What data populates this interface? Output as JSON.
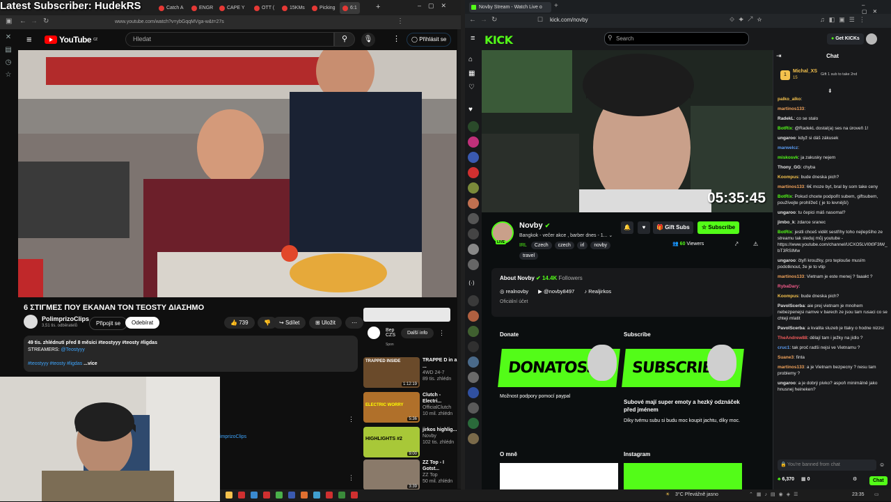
{
  "overlay": {
    "subscriber_text": "Latest Subscriber: HudekRS"
  },
  "left_browser": {
    "tabs": [
      "Catch A",
      "ENGR",
      "CAPE Y",
      "OTT (",
      "15KMs",
      "Picking",
      "6:1"
    ],
    "url": "www.youtube.com/watch?v=ybGqqMVga-w&t=27s",
    "youtube": {
      "logo": "YouTube",
      "region": "CZ",
      "search_placeholder": "Hledat",
      "signin": "Přihlásit se",
      "video_title": "6 ΣΤΙΓΜΕΣ ΠΟΥ ΕΚΑΝΑΝ ΤΟΝ ΤΕΟSTY ΔΙΑΣΗΜΟ",
      "channel_name": "PolimprizoClips",
      "channel_subs": "3,51 tis. odběratelů",
      "join_label": "Připojit se",
      "subscribe_label": "Odebírat",
      "likes": "739",
      "share_label": "Sdílet",
      "save_label": "Uložit",
      "desc_line1": "49 tis. zhlédnutí  před 8 měsíci  #teostyyy #teosty #ligdas",
      "desc_line2_prefix": "STREAMERS: ",
      "desc_line2_link": "@Teostyyy",
      "desc_line3": "#teostyyy #teosty #ligdas",
      "desc_more": "...více",
      "ad_title": "Bep CZS",
      "ad_sponsor": "Spon",
      "ad_button": "Další info",
      "comment_link": "imprizoClips",
      "recs": [
        {
          "title": "TRAPPE D in a ...",
          "channel": "4WD 24-7",
          "meta": "89 tis. zhlédn",
          "duration": "1:12:19",
          "thumb_text": "TRAPPED INSIDE",
          "color": "#6a4a2a"
        },
        {
          "title": "Clutch - Electri...",
          "channel": "OfficialClutch",
          "meta": "10 mil. zhlédn",
          "duration": "5:36",
          "thumb_text": "ELECTRIC WORRY",
          "color": "#b0702a"
        },
        {
          "title": "jirkos highlig...",
          "channel": "Novby",
          "meta": "102 tis. zhlédn",
          "duration": "9:00",
          "thumb_text": "HIGHLIGHTS #2",
          "color": "#a8c838"
        },
        {
          "title": "ZZ Top - I Gotst...",
          "channel": "ZZ Top",
          "meta": "50 mil. zhlédn",
          "duration": "3:39",
          "thumb_text": "",
          "color": "#8a7a6a"
        }
      ]
    }
  },
  "right_browser": {
    "tab_title": "Novby Stream - Watch Live o",
    "url": "kick.com/novby",
    "kick": {
      "logo": "KICK",
      "search_placeholder": "Search",
      "get_kicks": "Get KICKs",
      "timer": "05:35:45",
      "streamer_name": "Novby",
      "live_badge": "LIVE",
      "stream_title": "Bangkok - večer akce , barber dnes - 1...",
      "category": "IRL",
      "tags": [
        "Czech",
        "czech",
        "irl",
        "novby",
        "travel"
      ],
      "gift_subs": "Gift Subs",
      "subscribe": "Subscribe",
      "viewers": "60",
      "viewers_label": "Viewers",
      "about_title": "About Novby",
      "followers": "14.4K",
      "followers_label": "Followers",
      "socials": [
        "realnovby",
        "@novby8497",
        "Realjirkos"
      ],
      "official_account": "Oficiální účet",
      "panels": {
        "donate_title": "Donate",
        "donate_banner": "DONATOSS",
        "donate_text": "Možnost podpory pomocí paypal",
        "subscribe_title": "Subscribe",
        "subscribe_banner": "SUBSCRIBE",
        "subscribe_text1": "Subové mají super emoty a hezký odznáček před jménem",
        "subscribe_text2": "Díky tvému subu si budu moc koupit jachtu, díky moc.",
        "omne_title": "O mně",
        "instagram_title": "Instagram"
      }
    },
    "chat": {
      "title": "Chat",
      "pinned_user": "Michal_XS",
      "pinned_count": "15",
      "pinned_text": "Gift 1 sub to take 2nd",
      "messages": [
        {
          "user": "palko_alko",
          "color": "#f5c24d",
          "text": ""
        },
        {
          "user": "martinos133",
          "color": "#f2a35b",
          "text": ""
        },
        {
          "user": "RadekL",
          "color": "#e7e7e7",
          "text": "co se stalo"
        },
        {
          "user": "BotRix",
          "color": "#53fc18",
          "text": "@RadekL dostal(a) ses na úroveň 1!"
        },
        {
          "user": "ungaroo",
          "color": "#e7e7e7",
          "text": "když si dáš zákusek"
        },
        {
          "user": "marwelcz",
          "color": "#5b9cf2",
          "text": ""
        },
        {
          "user": "miskosvk",
          "color": "#53fc18",
          "text": "ja zakusky nejem"
        },
        {
          "user": "Thony_GG",
          "color": "#e7e7e7",
          "text": "chyba"
        },
        {
          "user": "Koompus",
          "color": "#f5c24d",
          "text": "bude dneska pich?"
        },
        {
          "user": "martinos133",
          "color": "#f2a35b",
          "text": "6€ moze byt, bral by som take ceny"
        },
        {
          "user": "BotRix",
          "color": "#53fc18",
          "text": "Pokud chcete podpořit subem, giftsubem, používejte prohlížeč ( je to levnější)"
        },
        {
          "user": "ungaroo",
          "color": "#e7e7e7",
          "text": "tu čepici máš nasomal?"
        },
        {
          "user": "jimbo_k",
          "color": "#e7e7e7",
          "text": "zdarce sranec"
        },
        {
          "user": "BotRix",
          "color": "#53fc18",
          "text": "jestli chceš vidět sestříhy toho nejlepšího ze streamu tak sleduj můj youtube - https://www.youtube.com/channel/UCXO5LVl0t0F3lW_bT3RSIMw"
        },
        {
          "user": "ungaroo",
          "color": "#e7e7e7",
          "text": "čtyři kroužky, pro teplouše musím podotknout, že je to vtip"
        },
        {
          "user": "martinos133",
          "color": "#f2a35b",
          "text": "Vietnam je este menej ? faaakt ?"
        },
        {
          "user": "RybaDary",
          "color": "#f25b8a",
          "text": ""
        },
        {
          "user": "Koompus",
          "color": "#f5c24d",
          "text": "bude dneska pich?"
        },
        {
          "user": "PavolScerba",
          "color": "#e7e7e7",
          "text": "aie prej vietnam je mnohem nebezpenejsi namve v barech ze jsou tam rusaci co se chteji mlatit"
        },
        {
          "user": "PavolScerba",
          "color": "#e7e7e7",
          "text": "a kvalita sluzeb je ttaky o hodne nizzsi"
        },
        {
          "user": "TheAndrew88",
          "color": "#f25b5b",
          "text": "dělají tam i ježky na jídlo ?"
        },
        {
          "user": "cruc1",
          "color": "#5b9cf2",
          "text": "tak proč radši nejsi ve Vietnamu ?"
        },
        {
          "user": "Suane3",
          "color": "#f2a35b",
          "text": "finta"
        },
        {
          "user": "martinos133",
          "color": "#f2a35b",
          "text": "a je Vietnam bezpecny ? nesu tam problemy ?"
        },
        {
          "user": "ungaroo",
          "color": "#e7e7e7",
          "text": "a je dobrý pivko? aspoň minimálně jako hnusnej heineken?"
        }
      ],
      "input_placeholder": "You're banned from chat",
      "kicks_count": "6,370",
      "zero_count": "0",
      "chat_button": "Chat"
    }
  },
  "taskbar": {
    "weather": "3°C  Převážně jasno",
    "time": "23:35"
  }
}
